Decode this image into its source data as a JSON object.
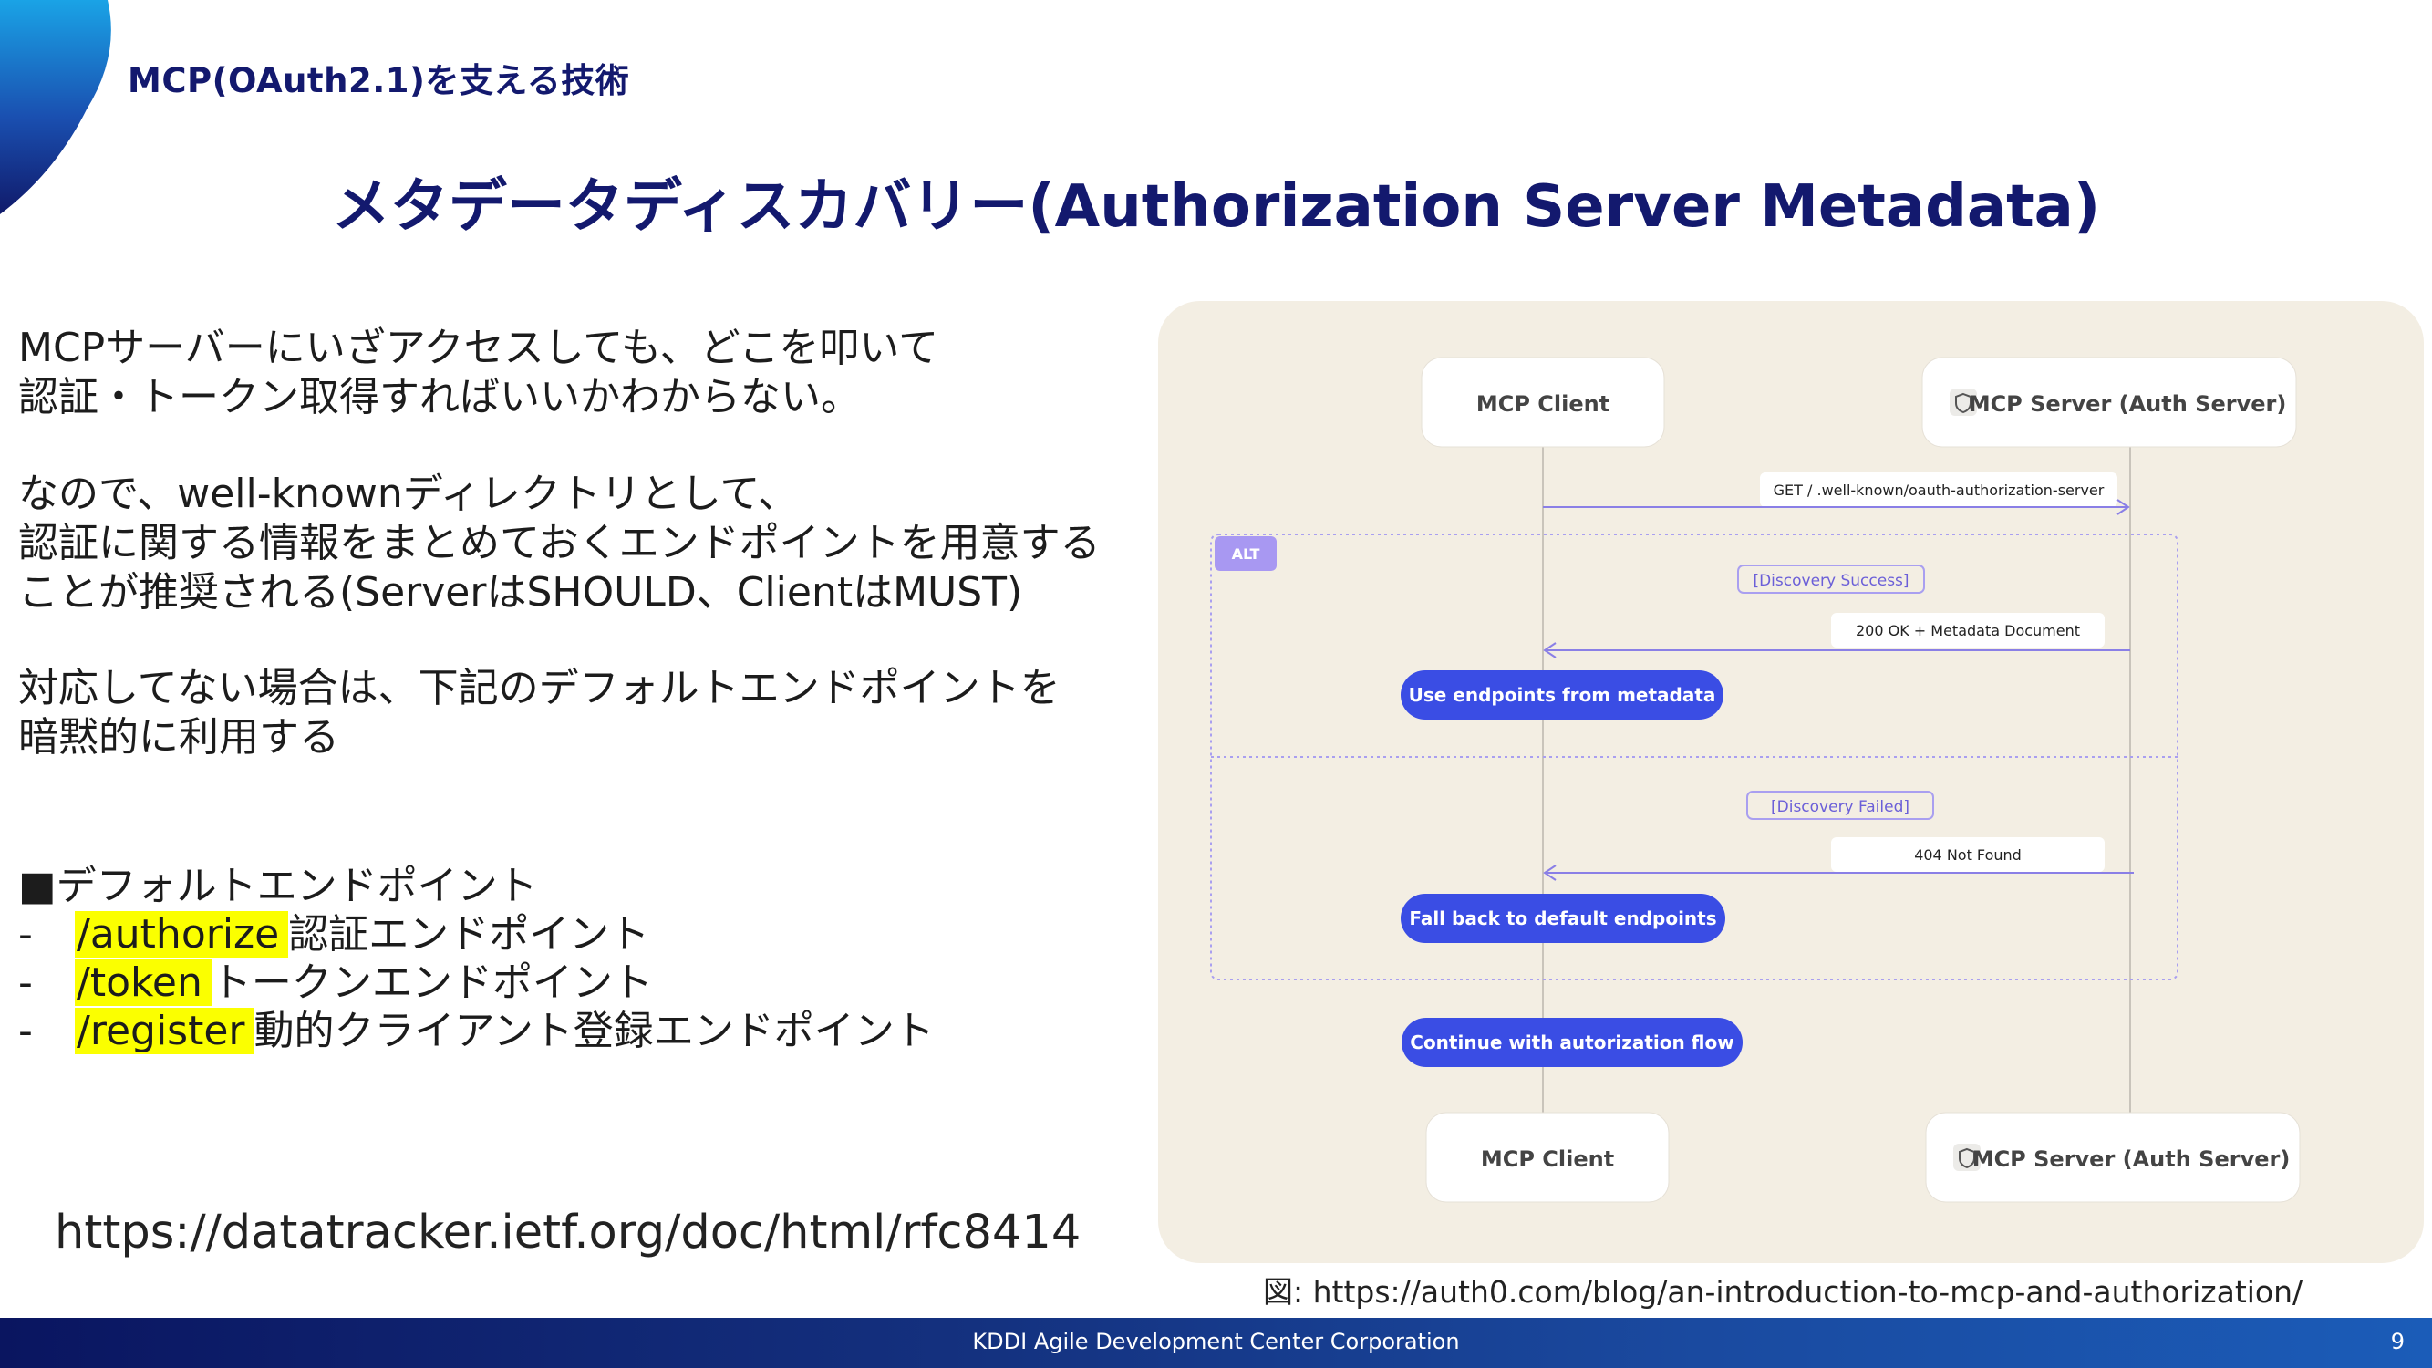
{
  "header": {
    "section_title": "MCP(OAuth2.1)を支える技術",
    "main_title": "メタデータディスカバリー(Authorization Server Metadata)"
  },
  "body": {
    "paragraph1": [
      "MCPサーバーにいざアクセスしても、どこを叩いて",
      "認証・トークン取得すればいいかわからない。"
    ],
    "paragraph2": [
      "なので、well-knownディレクトリとして、",
      "認証に関する情報をまとめておくエンドポイントを用意する",
      "ことが推奨される(ServerはSHOULD、ClientはMUST)"
    ],
    "paragraph3": [
      "対応してない場合は、下記のデフォルトエンドポイントを",
      "暗黙的に利用する"
    ],
    "list_heading": "■デフォルトエンドポイント",
    "endpoints": [
      {
        "bullet": "-",
        "path": "/authorize",
        "desc": "認証エンドポイント"
      },
      {
        "bullet": "-",
        "path": "/token",
        "desc": "トークンエンドポイント"
      },
      {
        "bullet": "-",
        "path": "/register",
        "desc": "動的クライアント登録エンドポイント"
      }
    ],
    "url": "https://datatracker.ietf.org/doc/html/rfc8414"
  },
  "diagram": {
    "client_label": "MCP Client",
    "server_label": "MCP Server (Auth Server)",
    "server_icon": "shield-icon",
    "request": "GET / .well-known/oauth-authorization-server",
    "alt_tag": "ALT",
    "success_guard": "[Discovery Success]",
    "success_response": "200 OK + Metadata Document",
    "success_action": "Use endpoints from metadata",
    "failed_guard": "[Discovery Failed]",
    "failed_response": "404 Not Found",
    "failed_action": "Fall back to default endpoints",
    "continue_action": "Continue with autorization flow",
    "colors": {
      "accent": "#3a4de4",
      "alt": "#9d8cf0",
      "arrow": "#8a7fe6",
      "background": "#f3eee3"
    }
  },
  "caption": "図: https://auth0.com/blog/an-introduction-to-mcp-and-authorization/",
  "footer": {
    "company": "KDDI Agile Development Center Corporation",
    "page": "9"
  }
}
